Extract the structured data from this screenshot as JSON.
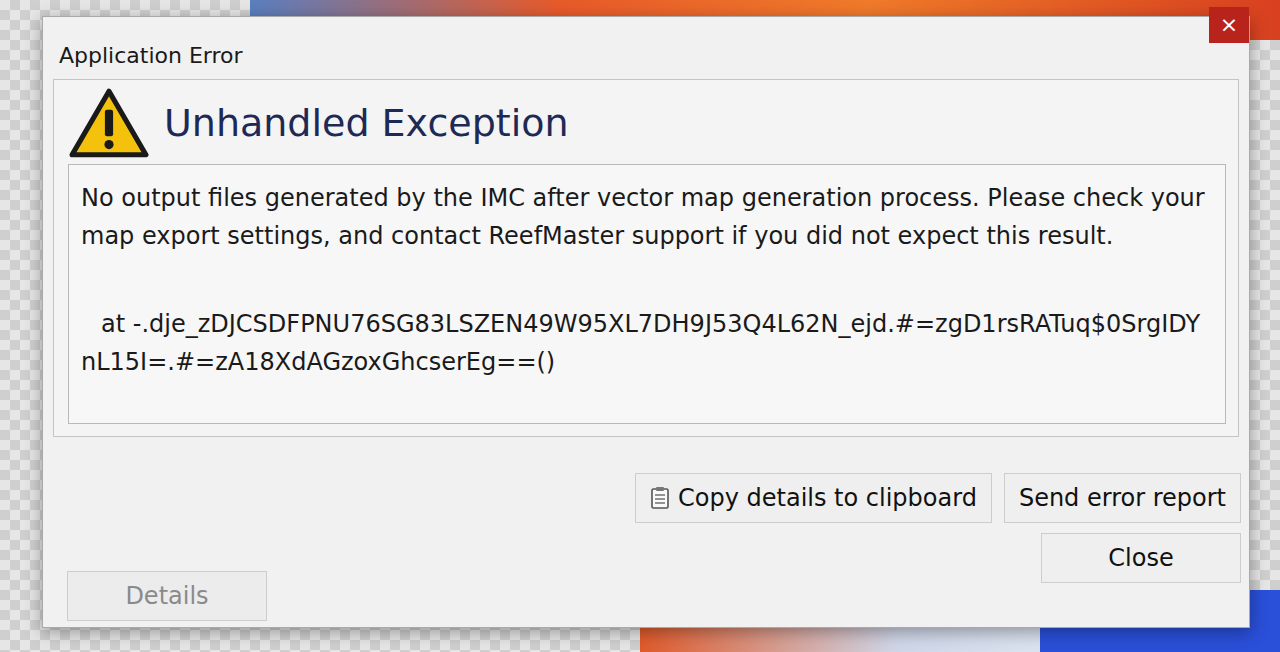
{
  "window": {
    "title": "Application Error",
    "close": "×"
  },
  "header": {
    "title": "Unhandled Exception"
  },
  "message": "No output files generated by the IMC after vector map generation process. Please check your map export settings, and contact ReefMaster support if you did not expect this result.",
  "stack": "at -.dje_zDJCSDFPNU76SG83LSZEN49W95XL7DH9J53Q4L62N_ejd.#=zgD1rsRATuq$0SrgIDYnL15I=.#=zA18XdAGzoxGhcserEg==()",
  "buttons": [
    {
      "label": "Copy details to clipboard",
      "kind": "icon"
    },
    {
      "label": "Send error report",
      "kind": "plain"
    }
  ],
  "close_button": {
    "label": "Close"
  },
  "details_button": {
    "label": "Details",
    "disabled": true
  }
}
